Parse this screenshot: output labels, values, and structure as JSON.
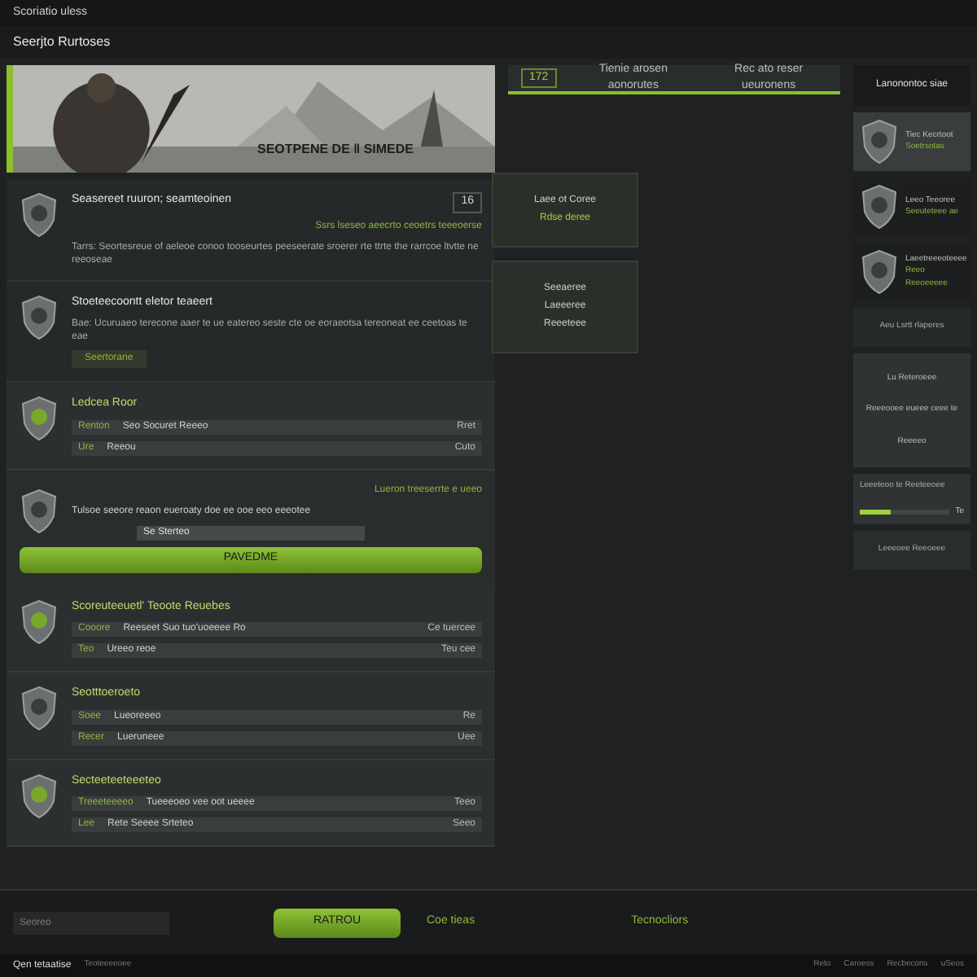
{
  "top_bar": {
    "title": "Scoriatio uless"
  },
  "page_title": "Seerjto Rurtoses",
  "banner": {
    "kind": "picture",
    "caption": "SEOTPENE DE ‖ SIMEDE"
  },
  "tabs": [
    {
      "label": "172",
      "selected": true
    },
    {
      "label": "Tienie arosen aonorutes",
      "selected": false
    },
    {
      "label": "Rec ato reser ueuronens",
      "selected": false
    }
  ],
  "feed": [
    {
      "kind": "post",
      "title": "Seasereet ruuron; seamteoinen",
      "body": "Tarrs: Seortesreue of aeleoe conoo tooseurtes peeseerate sroerer rte ttrte the rarrcoe ltvtte ne reeoseae",
      "count": "16",
      "note": "Ssrs lseseo aeecrto ceoetrs teeeoerse"
    },
    {
      "kind": "post",
      "title": "Stoeteecoontt eletor teaeert",
      "body": "Bae: Ucuruaeo terecone aaer te ue eatereo seste cte oe eoraeotsa tereoneat ee ceetoas te eae",
      "action": "Seertorane"
    },
    {
      "kind": "listing",
      "title": "Ledcea Roor",
      "rows": [
        {
          "label": "Renton",
          "value": "Seo Socuret Reeeo",
          "price": "Rret"
        },
        {
          "label": "Ure",
          "value": "Reeou",
          "price": "Cuto"
        }
      ]
    },
    {
      "kind": "offer",
      "title": "Tulsoe seeore reaon eueroaty doe ee ooe eeo eeeotee",
      "note": "Lueron treeserrte e ueeo",
      "field": "Se Sterteo",
      "button": "PAVEDME"
    },
    {
      "kind": "listing",
      "title": "Scoreuteeuetl' Teoote Reuebes",
      "rows": [
        {
          "label": "Cooore",
          "value": "Reeseet Suo tuo'uoeeee Ro",
          "price": "Ce tuercee"
        },
        {
          "label": "Teo",
          "value": "Ureeo reoe",
          "price": "Teu cee"
        }
      ]
    },
    {
      "kind": "listing",
      "title": "Seotttoeroeto",
      "rows": [
        {
          "label": "Soee",
          "value": "Lueoreeeo",
          "price": "Re"
        },
        {
          "label": "Recer",
          "value": "Lueruneee",
          "price": "Uee"
        }
      ]
    },
    {
      "kind": "listing",
      "title": "Secteeteeteeeteo",
      "rows": [
        {
          "label": "Treeeteeeeo",
          "value": "Tueeeoeo vee oot ueeee",
          "price": "Teeo"
        },
        {
          "label": "Lee",
          "value": "Rete Seeee Srteteo",
          "price": "Seeo"
        }
      ]
    }
  ],
  "side_panels": [
    {
      "lines": [
        "Laee ot Coree",
        "Rdse deree"
      ]
    },
    {
      "lines": [
        "Seeaeree",
        "Laeeeree",
        "Reeeteee"
      ]
    }
  ],
  "sidebar": {
    "title": "Lanonontoc siae",
    "items": [
      {
        "title": "Tiec Kecrtoot",
        "subtitle": "Soetrsotas",
        "selected": true
      },
      {
        "title": "Leeo Teeoree",
        "subtitle": "Seeuteteee ae",
        "selected": false
      },
      {
        "title": "Laeetreeeoteeee",
        "subtitle": "Reeo Reeoeeeee",
        "selected": false
      }
    ],
    "footer": "Aeu Lsrtt rlaperes"
  },
  "promo": {
    "title": "Lu Reteroeee",
    "body": "Reeeooee eueee ceee te",
    "label": "Reeeeo"
  },
  "filter": {
    "title": "Leeeteoo te Reeteeoee",
    "level": 0.35,
    "value": "Te"
  },
  "footer_card": {
    "title": "Leeeoee Reeoeee"
  },
  "composer": {
    "placeholder": "Seoreo",
    "button": "RATROU",
    "link": "Coe tieas",
    "aside": "Tecnocliors"
  },
  "status_bar": {
    "left": "Qen tetaatise",
    "sub": "Teoteeeeoee",
    "right": [
      "Reto",
      "Caroess",
      "Recbecons",
      "uSeos"
    ]
  }
}
